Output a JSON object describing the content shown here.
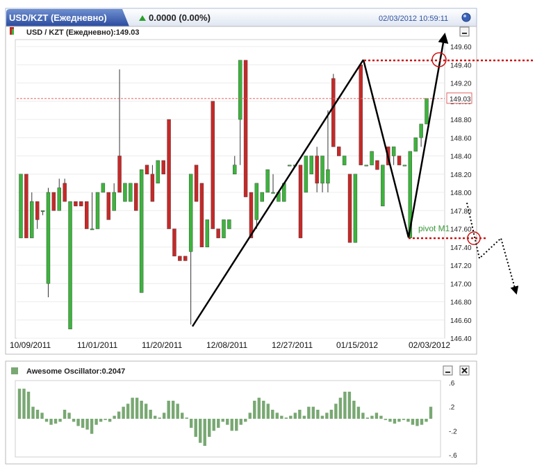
{
  "header": {
    "tab_title": "USD/KZT (Ежедневно)",
    "change": "0.0000 (0.00%)",
    "datetime": "02/03/2012 10:59:11"
  },
  "price_panel": {
    "label": "USD / KZT (Ежедневно):149.03",
    "last_value_tag": "149.03"
  },
  "oscillator_panel": {
    "label": "Awesome Oscillator:0.2047"
  },
  "annotations": {
    "pivot_label": "pivot M1"
  },
  "colors": {
    "up": "#3cb43c",
    "down": "#c82828",
    "ao_bar": "#79a873",
    "price_line": "#e06060",
    "pivot_line": "#cc1111"
  },
  "chart_data": [
    {
      "type": "candlestick",
      "ylim": [
        146.4,
        149.6
      ],
      "y_ticks": [
        "146.40",
        "146.60",
        "146.80",
        "147.00",
        "147.20",
        "147.40",
        "147.60",
        "147.80",
        "148.00",
        "148.20",
        "148.40",
        "148.60",
        "148.80",
        "149.00",
        "149.20",
        "149.40",
        "149.60"
      ],
      "x_ticks": [
        "10/09/2011",
        "11/01/2011",
        "11/20/2011",
        "12/08/2011",
        "12/27/2011",
        "01/15/2012",
        "02/03/2012"
      ],
      "last_price": 149.03,
      "candles": [
        {
          "o": 147.5,
          "h": 148.2,
          "l": 147.5,
          "c": 148.2
        },
        {
          "o": 148.2,
          "h": 148.2,
          "l": 147.5,
          "c": 147.5
        },
        {
          "o": 147.5,
          "h": 148.0,
          "l": 147.5,
          "c": 147.9
        },
        {
          "o": 147.9,
          "h": 147.9,
          "l": 147.6,
          "c": 147.7
        },
        {
          "o": 147.8,
          "h": 147.8,
          "l": 147.75,
          "c": 147.8
        },
        {
          "o": 147.0,
          "h": 148.05,
          "l": 146.85,
          "c": 148.0
        },
        {
          "o": 148.0,
          "h": 148.0,
          "l": 147.8,
          "c": 147.8
        },
        {
          "o": 147.8,
          "h": 148.15,
          "l": 147.8,
          "c": 148.05
        },
        {
          "o": 148.1,
          "h": 148.15,
          "l": 147.9,
          "c": 147.9
        },
        {
          "o": 146.5,
          "h": 147.9,
          "l": 146.5,
          "c": 147.9
        },
        {
          "o": 147.9,
          "h": 147.9,
          "l": 147.85,
          "c": 147.85
        },
        {
          "o": 147.9,
          "h": 147.9,
          "l": 147.85,
          "c": 147.85
        },
        {
          "o": 147.9,
          "h": 147.9,
          "l": 147.6,
          "c": 147.6
        },
        {
          "o": 147.6,
          "h": 148.0,
          "l": 147.6,
          "c": 147.6
        },
        {
          "o": 147.6,
          "h": 148.0,
          "l": 147.6,
          "c": 148.0
        },
        {
          "o": 148.0,
          "h": 148.1,
          "l": 148.0,
          "c": 148.1
        },
        {
          "o": 148.0,
          "h": 148.0,
          "l": 147.7,
          "c": 147.7
        },
        {
          "o": 147.8,
          "h": 148.1,
          "l": 147.8,
          "c": 148.0
        },
        {
          "o": 148.4,
          "h": 149.35,
          "l": 148.0,
          "c": 148.0
        },
        {
          "o": 147.9,
          "h": 148.1,
          "l": 147.9,
          "c": 148.1
        },
        {
          "o": 147.9,
          "h": 148.1,
          "l": 147.9,
          "c": 148.1
        },
        {
          "o": 148.1,
          "h": 148.1,
          "l": 147.8,
          "c": 147.8
        },
        {
          "o": 146.9,
          "h": 148.25,
          "l": 146.9,
          "c": 148.25
        },
        {
          "o": 148.3,
          "h": 148.3,
          "l": 148.2,
          "c": 148.2
        },
        {
          "o": 148.2,
          "h": 148.3,
          "l": 147.9,
          "c": 147.9
        },
        {
          "o": 148.1,
          "h": 148.35,
          "l": 148.1,
          "c": 148.35
        },
        {
          "o": 148.35,
          "h": 148.35,
          "l": 148.2,
          "c": 148.2
        },
        {
          "o": 148.8,
          "h": 148.8,
          "l": 147.6,
          "c": 147.6
        },
        {
          "o": 147.6,
          "h": 147.6,
          "l": 147.3,
          "c": 147.3
        },
        {
          "o": 147.3,
          "h": 147.3,
          "l": 147.25,
          "c": 147.25
        },
        {
          "o": 147.3,
          "h": 147.3,
          "l": 147.25,
          "c": 147.25
        },
        {
          "o": 147.35,
          "h": 148.2,
          "l": 146.55,
          "c": 148.2
        },
        {
          "o": 148.3,
          "h": 148.3,
          "l": 147.9,
          "c": 147.9
        },
        {
          "o": 148.1,
          "h": 148.1,
          "l": 147.4,
          "c": 147.4
        },
        {
          "o": 147.4,
          "h": 147.7,
          "l": 147.4,
          "c": 147.7
        },
        {
          "o": 149.0,
          "h": 149.0,
          "l": 147.6,
          "c": 147.6
        },
        {
          "o": 147.6,
          "h": 147.6,
          "l": 147.5,
          "c": 147.5
        },
        {
          "o": 147.5,
          "h": 147.7,
          "l": 147.5,
          "c": 147.7
        },
        {
          "o": 147.6,
          "h": 147.7,
          "l": 147.6,
          "c": 147.7
        },
        {
          "o": 148.2,
          "h": 148.4,
          "l": 148.2,
          "c": 148.3
        },
        {
          "o": 148.8,
          "h": 149.45,
          "l": 148.3,
          "c": 149.45
        },
        {
          "o": 149.45,
          "h": 149.45,
          "l": 147.95,
          "c": 147.95
        },
        {
          "o": 148.0,
          "h": 148.0,
          "l": 147.5,
          "c": 147.5
        },
        {
          "o": 147.7,
          "h": 148.1,
          "l": 147.6,
          "c": 148.1
        },
        {
          "o": 147.9,
          "h": 148.0,
          "l": 147.9,
          "c": 148.0
        },
        {
          "o": 148.0,
          "h": 148.25,
          "l": 148.0,
          "c": 148.25
        },
        {
          "o": 148.0,
          "h": 148.2,
          "l": 148.0,
          "c": 148.0
        },
        {
          "o": 147.9,
          "h": 148.0,
          "l": 147.9,
          "c": 148.0
        },
        {
          "o": 147.9,
          "h": 148.1,
          "l": 147.9,
          "c": 148.1
        },
        {
          "o": 148.3,
          "h": 148.3,
          "l": 148.3,
          "c": 148.3
        },
        {
          "o": 148.3,
          "h": 148.3,
          "l": 148.3,
          "c": 148.3
        },
        {
          "o": 148.3,
          "h": 148.3,
          "l": 147.5,
          "c": 147.5
        },
        {
          "o": 148.0,
          "h": 148.4,
          "l": 148.0,
          "c": 148.4
        },
        {
          "o": 148.2,
          "h": 148.4,
          "l": 148.2,
          "c": 148.4
        },
        {
          "o": 148.4,
          "h": 148.5,
          "l": 148.0,
          "c": 148.1
        },
        {
          "o": 148.1,
          "h": 148.4,
          "l": 148.0,
          "c": 148.4
        },
        {
          "o": 148.1,
          "h": 148.9,
          "l": 148.0,
          "c": 148.25
        },
        {
          "o": 149.25,
          "h": 149.3,
          "l": 148.5,
          "c": 148.5
        },
        {
          "o": 148.5,
          "h": 148.5,
          "l": 148.4,
          "c": 148.4
        },
        {
          "o": 148.3,
          "h": 148.4,
          "l": 148.3,
          "c": 148.4
        },
        {
          "o": 148.2,
          "h": 148.2,
          "l": 147.45,
          "c": 147.45
        },
        {
          "o": 147.45,
          "h": 148.2,
          "l": 147.45,
          "c": 148.2
        },
        {
          "o": 149.4,
          "h": 149.4,
          "l": 148.3,
          "c": 148.3
        },
        {
          "o": 148.3,
          "h": 148.3,
          "l": 148.3,
          "c": 148.3
        },
        {
          "o": 148.3,
          "h": 148.45,
          "l": 148.3,
          "c": 148.45
        },
        {
          "o": 148.35,
          "h": 148.35,
          "l": 148.25,
          "c": 148.25
        },
        {
          "o": 147.85,
          "h": 148.3,
          "l": 147.85,
          "c": 148.3
        },
        {
          "o": 148.5,
          "h": 148.5,
          "l": 148.3,
          "c": 148.3
        },
        {
          "o": 148.4,
          "h": 148.5,
          "l": 148.3,
          "c": 148.5
        },
        {
          "o": 148.4,
          "h": 148.4,
          "l": 148.3,
          "c": 148.3
        },
        {
          "o": 148.3,
          "h": 148.3,
          "l": 148.3,
          "c": 148.3
        },
        {
          "o": 147.5,
          "h": 148.45,
          "l": 147.5,
          "c": 148.45
        },
        {
          "o": 148.45,
          "h": 148.6,
          "l": 148.45,
          "c": 148.6
        },
        {
          "o": 148.6,
          "h": 148.75,
          "l": 148.5,
          "c": 148.75
        },
        {
          "o": 148.75,
          "h": 149.03,
          "l": 148.75,
          "c": 149.03
        }
      ]
    },
    {
      "type": "bar",
      "ylim": [
        -0.6,
        0.6
      ],
      "y_ticks": [
        ".6",
        ".2",
        "-.2",
        "-.6"
      ],
      "values": [
        0.5,
        0.5,
        0.45,
        0.2,
        0.15,
        0.1,
        -0.05,
        -0.1,
        -0.08,
        -0.05,
        0.15,
        0.1,
        -0.05,
        -0.12,
        -0.15,
        -0.18,
        -0.25,
        -0.1,
        -0.05,
        -0.02,
        -0.05,
        0.05,
        0.12,
        0.2,
        0.25,
        0.35,
        0.35,
        0.3,
        0.25,
        0.15,
        0.05,
        0.02,
        0.1,
        0.3,
        0.3,
        0.25,
        0.1,
        0.02,
        -0.15,
        -0.3,
        -0.4,
        -0.45,
        -0.3,
        -0.2,
        -0.15,
        -0.05,
        -0.1,
        -0.2,
        -0.2,
        -0.1,
        -0.05,
        0.1,
        0.3,
        0.35,
        0.3,
        0.25,
        0.15,
        0.1,
        0.05,
        0.02,
        0.05,
        0.1,
        0.15,
        0.05,
        0.2,
        0.2,
        0.15,
        0.05,
        0.1,
        0.15,
        0.25,
        0.35,
        0.45,
        0.45,
        0.3,
        0.2,
        0.1,
        0.02,
        0.05,
        0.1,
        0.05,
        -0.02,
        -0.05,
        -0.08,
        -0.05,
        -0.02,
        -0.05,
        -0.1,
        -0.12,
        -0.1,
        -0.05,
        0.2
      ]
    }
  ]
}
